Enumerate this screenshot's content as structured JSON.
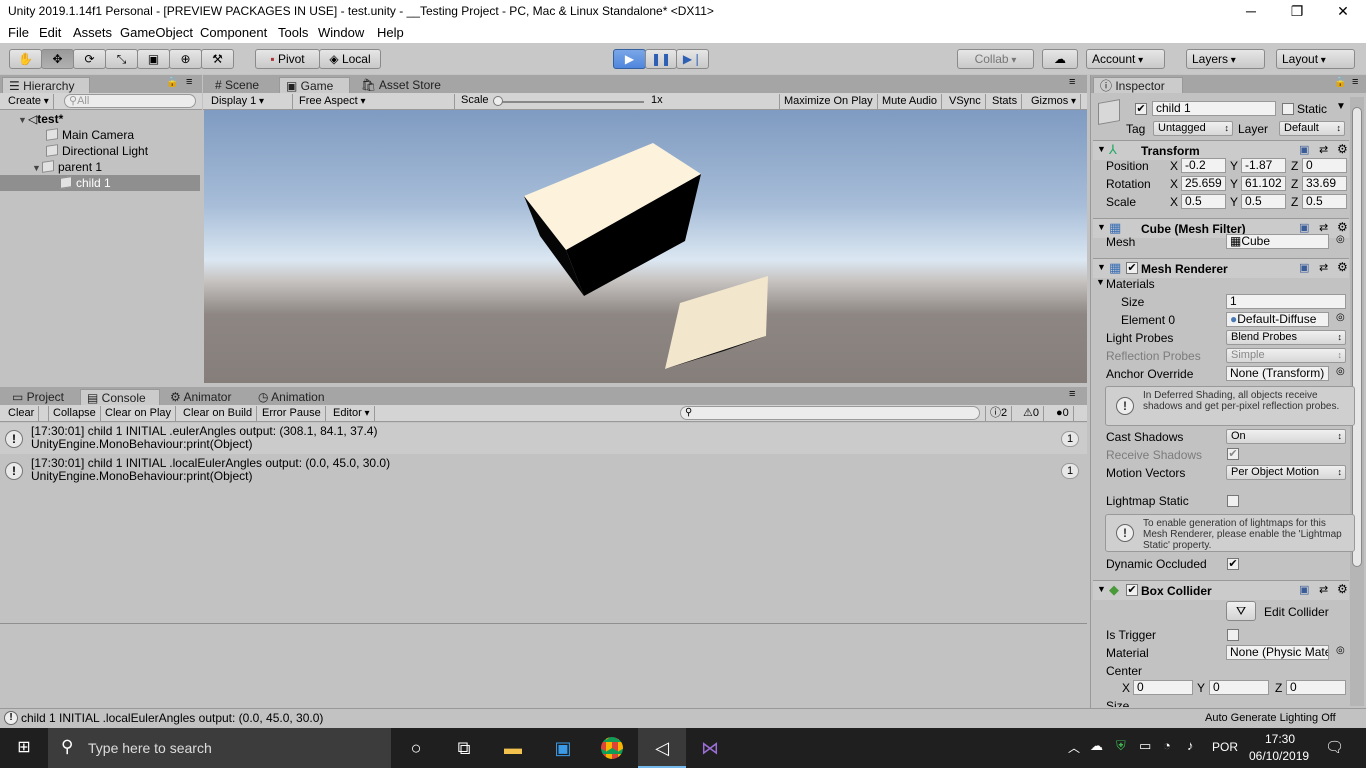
{
  "window": {
    "title": "Unity 2019.1.14f1 Personal - [PREVIEW PACKAGES IN USE] - test.unity - __Testing Project - PC, Mac & Linux Standalone* <DX11>",
    "minimize": "─",
    "restore": "❐",
    "close": "✕"
  },
  "menu": [
    "File",
    "Edit",
    "Assets",
    "GameObject",
    "Component",
    "Tools",
    "Window",
    "Help"
  ],
  "toolbar": {
    "pivot": "Pivot",
    "local": "Local",
    "collab": "Collab",
    "account": "Account",
    "layers": "Layers",
    "layout": "Layout"
  },
  "hierarchy": {
    "tab": "Hierarchy",
    "create": "Create",
    "search_placeholder": "All",
    "scene": "test*",
    "items": [
      "Main Camera",
      "Directional Light",
      "parent 1",
      "child 1"
    ]
  },
  "game_view": {
    "tabs": [
      "Scene",
      "Game",
      "Asset Store"
    ],
    "display": "Display 1",
    "aspect": "Free Aspect",
    "scale_label": "Scale",
    "scale_value": "1x",
    "toggles": [
      "Maximize On Play",
      "Mute Audio",
      "VSync",
      "Stats",
      "Gizmos"
    ]
  },
  "console": {
    "tabs": [
      "Project",
      "Console",
      "Animator",
      "Animation"
    ],
    "buttons": [
      "Clear",
      "Collapse",
      "Clear on Play",
      "Clear on Build",
      "Error Pause",
      "Editor"
    ],
    "counts": {
      "info": "2",
      "warn": "0",
      "error": "0"
    },
    "entries": [
      {
        "line1": "[17:30:01] child 1 INITIAL .eulerAngles output: (308.1, 84.1, 37.4)",
        "line2": "UnityEngine.MonoBehaviour:print(Object)",
        "count": "1"
      },
      {
        "line1": "[17:30:01] child 1 INITIAL .localEulerAngles output: (0.0, 45.0, 30.0)",
        "line2": "UnityEngine.MonoBehaviour:print(Object)",
        "count": "1"
      }
    ]
  },
  "status": {
    "message": "child 1 INITIAL .localEulerAngles output: (0.0, 45.0, 30.0)",
    "right": "Auto Generate Lighting Off"
  },
  "inspector": {
    "tab": "Inspector",
    "name": "child 1",
    "static": "Static",
    "tag_label": "Tag",
    "tag": "Untagged",
    "layer_label": "Layer",
    "layer": "Default",
    "transform": {
      "title": "Transform",
      "position_label": "Position",
      "position": [
        "-0.2",
        "-1.87",
        "0"
      ],
      "rotation_label": "Rotation",
      "rotation": [
        "25.659",
        "61.102",
        "33.69"
      ],
      "scale_label": "Scale",
      "scale": [
        "0.5",
        "0.5",
        "0.5"
      ],
      "axes": [
        "X",
        "Y",
        "Z"
      ]
    },
    "mesh_filter": {
      "title": "Cube (Mesh Filter)",
      "mesh_label": "Mesh",
      "mesh": "Cube"
    },
    "mesh_renderer": {
      "title": "Mesh Renderer",
      "materials": "Materials",
      "size_label": "Size",
      "size": "1",
      "element_label": "Element 0",
      "element": "Default-Diffuse",
      "light_probes_label": "Light Probes",
      "light_probes": "Blend Probes",
      "reflection_label": "Reflection Probes",
      "reflection": "Simple",
      "anchor_label": "Anchor Override",
      "anchor": "None (Transform)",
      "deferred_help": "In Deferred Shading, all objects receive shadows and get per-pixel reflection probes.",
      "cast_label": "Cast Shadows",
      "cast": "On",
      "receive_label": "Receive Shadows",
      "motion_label": "Motion Vectors",
      "motion": "Per Object Motion",
      "lightmap_label": "Lightmap Static",
      "lightmap_help": "To enable generation of lightmaps for this Mesh Renderer, please enable the 'Lightmap Static' property.",
      "dynamic_label": "Dynamic Occluded"
    },
    "box_collider": {
      "title": "Box Collider",
      "edit": "Edit Collider",
      "trigger_label": "Is Trigger",
      "material_label": "Material",
      "material": "None (Physic Mate",
      "center_label": "Center",
      "center": [
        "0",
        "0",
        "0"
      ],
      "size_label": "Size"
    }
  },
  "taskbar": {
    "search_placeholder": "Type here to search",
    "lang": "POR",
    "time": "17:30",
    "date": "06/10/2019"
  },
  "colors": {
    "play_blue": "#4f86dd",
    "sky_top": "#8aa3c4",
    "ground": "#857e7a",
    "cube_face": "#fdf3dc"
  }
}
